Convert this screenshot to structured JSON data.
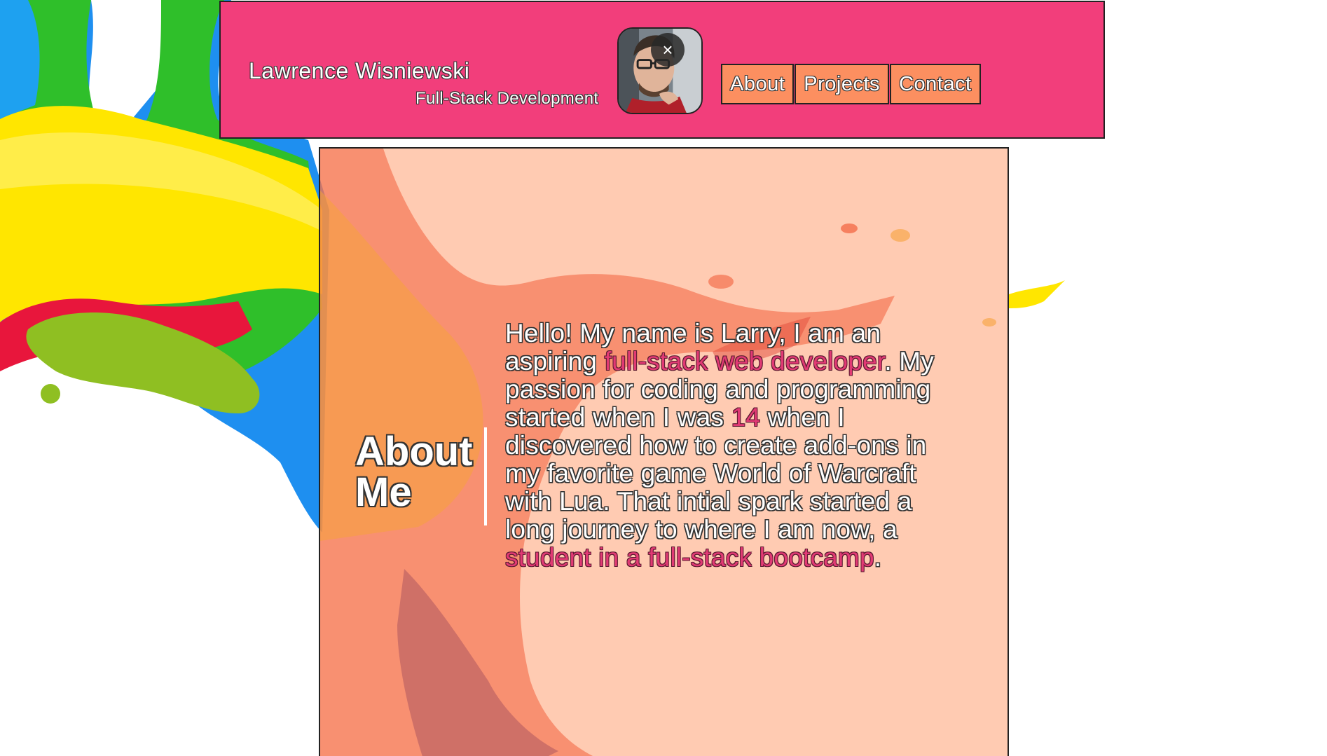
{
  "header": {
    "name": "Lawrence Wisniewski",
    "tagline": "Full-Stack Development",
    "close_symbol": "×",
    "nav": [
      "About",
      "Projects",
      "Contact"
    ]
  },
  "about": {
    "heading_line1": "About",
    "heading_line2": "Me",
    "text": {
      "p1": "Hello! My name is Larry, I am an aspiring ",
      "h1": "full-stack web developer",
      "p2": ". My passion for coding and programming started when I was ",
      "h2": "14",
      "p3": " when I discovered how to create add-ons in my favorite game World of Warcraft with Lua. That intial spark started a long journey to where I am now, a ",
      "h3": "student in a full-stack bootcamp",
      "p4": "."
    }
  },
  "colors": {
    "header_bg": "#f23e7b",
    "nav_bg": "#fc8f60",
    "panel_bg": "#ff9a72",
    "highlight": "#e13a74"
  },
  "icons": {
    "close": "close-icon",
    "avatar": "profile-photo"
  }
}
